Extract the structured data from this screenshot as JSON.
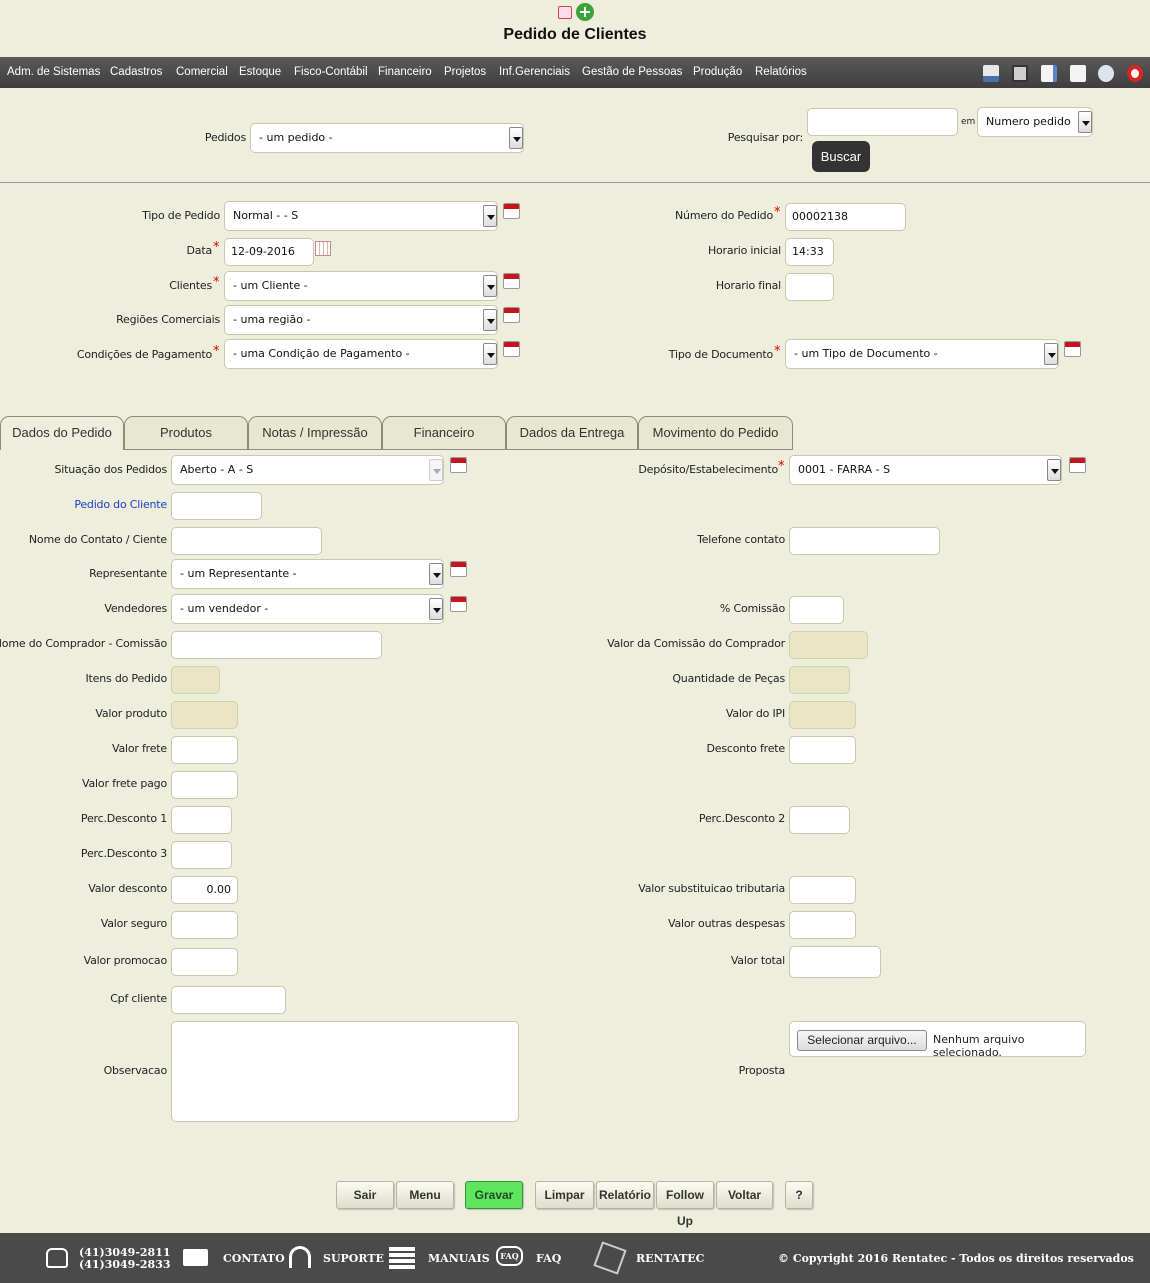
{
  "header": {
    "title": "Pedido de Clientes"
  },
  "menu": [
    "Adm. de Sistemas",
    "Cadastros",
    "Comercial",
    "Estoque",
    "Fisco-Contábil",
    "Financeiro",
    "Projetos",
    "Inf.Gerenciais",
    "Gestão de Pessoas",
    "Produção",
    "Relatórios"
  ],
  "search": {
    "pedidos_label": "Pedidos",
    "pedidos_value": "- um pedido -",
    "pesquisar_label": "Pesquisar por:",
    "em_label": "em",
    "field_value": "Numero pedido",
    "buscar_label": "Buscar",
    "query_value": ""
  },
  "form": {
    "tipo_pedido_label": "Tipo de Pedido",
    "tipo_pedido_value": "Normal - - S",
    "data_label": "Data",
    "data_value": "12-09-2016",
    "clientes_label": "Clientes",
    "clientes_value": "- um Cliente -",
    "regioes_label": "Regiões Comerciais",
    "regioes_value": "- uma região -",
    "condicoes_label": "Condições de Pagamento",
    "condicoes_value": "- uma Condição de Pagamento -",
    "numero_label": "Número do Pedido",
    "numero_value": "00002138",
    "hinicial_label": "Horario inicial",
    "hinicial_value": "14:33",
    "hfinal_label": "Horario final",
    "hfinal_value": "",
    "tipodoc_label": "Tipo de Documento",
    "tipodoc_value": "- um Tipo de Documento -"
  },
  "tabs": [
    "Dados do Pedido",
    "Produtos",
    "Notas / Impressão",
    "Financeiro",
    "Dados da Entrega",
    "Movimento do Pedido"
  ],
  "details": {
    "situacao_label": "Situação dos Pedidos",
    "situacao_value": "Aberto - A - S",
    "deposito_label": "Depósito/Estabelecimento",
    "deposito_value": "0001 - FARRA - S",
    "pedido_cliente_label": "Pedido do Cliente",
    "nome_contato_label": "Nome do Contato / Ciente",
    "telefone_label": "Telefone contato",
    "representante_label": "Representante",
    "representante_value": "- um Representante -",
    "vendedores_label": "Vendedores",
    "vendedores_value": "- um vendedor -",
    "comissao_label": "% Comissão",
    "nome_comprador_label": "Nome do Comprador - Comissão",
    "valor_comissao_label": "Valor da Comissão do Comprador",
    "itens_label": "Itens do Pedido",
    "qtd_pecas_label": "Quantidade de Peças",
    "valor_produto_label": "Valor produto",
    "valor_ipi_label": "Valor do IPI",
    "valor_frete_label": "Valor frete",
    "desconto_frete_label": "Desconto frete",
    "valor_frete_pago_label": "Valor frete pago",
    "perc1_label": "Perc.Desconto 1",
    "perc2_label": "Perc.Desconto 2",
    "perc3_label": "Perc.Desconto 3",
    "valor_desconto_label": "Valor desconto",
    "valor_desconto_value": "0.00",
    "valor_subst_label": "Valor substituicao tributaria",
    "valor_seguro_label": "Valor seguro",
    "valor_outras_label": "Valor outras despesas",
    "valor_promocao_label": "Valor promocao",
    "valor_total_label": "Valor total",
    "cpf_label": "Cpf cliente",
    "observacao_label": "Observacao",
    "proposta_label": "Proposta",
    "file_button": "Selecionar arquivo...",
    "file_status": "Nenhum arquivo selecionado."
  },
  "buttons": {
    "sair": "Sair",
    "menu": "Menu",
    "gravar": "Gravar",
    "limpar": "Limpar",
    "relatorio": "Relatório",
    "followup": "Follow Up",
    "voltar": "Voltar",
    "help": "?"
  },
  "footer": {
    "phone1": "(41)3049-2811",
    "phone2": "(41)3049-2833",
    "contato": "CONTATO",
    "suporte": "SUPORTE",
    "manuais": "MANUAIS",
    "faq_badge": "FAQ",
    "faq": "FAQ",
    "rentatec": "RENTATEC",
    "copyright": "© Copyright 2016 Rentatec - Todos os direitos reservados"
  },
  "colors": {
    "background": "#eeeedc",
    "toolbar": "#4a4a4a",
    "gravar": "#5de65d",
    "required": "#dd0000",
    "link": "#1a3fc4"
  }
}
